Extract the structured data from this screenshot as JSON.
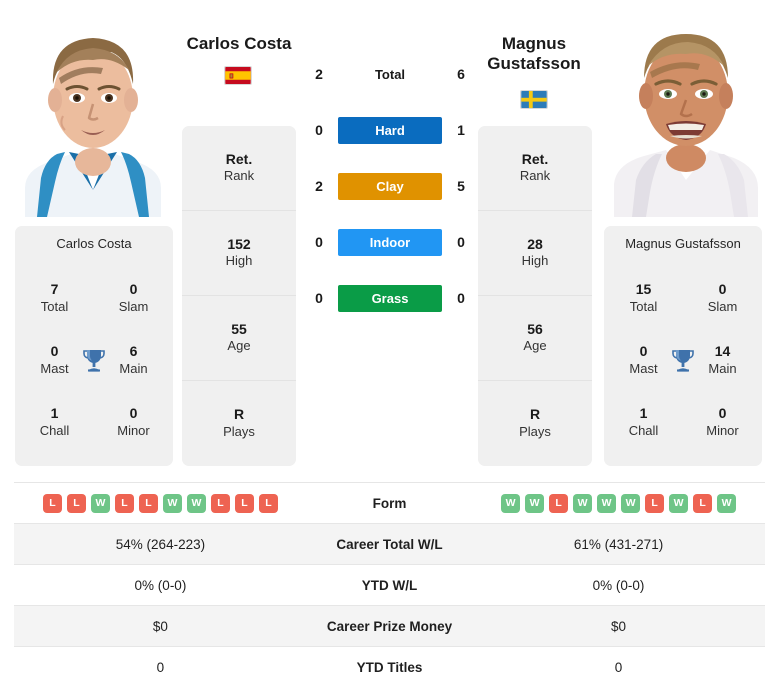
{
  "colors": {
    "hard": "#0a6cbf",
    "clay": "#e09200",
    "indoor": "#2196f3",
    "grass": "#0a9c47",
    "win": "#6ec587",
    "loss": "#ee6352",
    "trophy": "#3f72ab",
    "card_bg": "#f0f0f0"
  },
  "left_player": {
    "name": "Carlos Costa",
    "flag": "spain-flag",
    "photo": "carlos-costa-photo",
    "rank": [
      {
        "value": "Ret.",
        "label": "Rank"
      },
      {
        "value": "152",
        "label": "High"
      },
      {
        "value": "55",
        "label": "Age"
      },
      {
        "value": "R",
        "label": "Plays"
      }
    ],
    "titles_card_name": "Carlos Costa",
    "titles": [
      {
        "value": "7",
        "label": "Total"
      },
      {
        "value": "0",
        "label": "Slam"
      },
      {
        "value": "0",
        "label": "Mast"
      },
      {
        "value": "6",
        "label": "Main"
      },
      {
        "value": "1",
        "label": "Chall"
      },
      {
        "value": "0",
        "label": "Minor"
      }
    ],
    "form": [
      "L",
      "L",
      "W",
      "L",
      "L",
      "W",
      "W",
      "L",
      "L",
      "L"
    ]
  },
  "right_player": {
    "name": "Magnus Gustafsson",
    "flag": "sweden-flag",
    "photo": "magnus-gustafsson-photo",
    "rank": [
      {
        "value": "Ret.",
        "label": "Rank"
      },
      {
        "value": "28",
        "label": "High"
      },
      {
        "value": "56",
        "label": "Age"
      },
      {
        "value": "R",
        "label": "Plays"
      }
    ],
    "titles_card_name": "Magnus Gustafsson",
    "titles": [
      {
        "value": "15",
        "label": "Total"
      },
      {
        "value": "0",
        "label": "Slam"
      },
      {
        "value": "0",
        "label": "Mast"
      },
      {
        "value": "14",
        "label": "Main"
      },
      {
        "value": "1",
        "label": "Chall"
      },
      {
        "value": "0",
        "label": "Minor"
      }
    ],
    "form": [
      "W",
      "W",
      "L",
      "W",
      "W",
      "W",
      "L",
      "W",
      "L",
      "W"
    ]
  },
  "surfaces": [
    {
      "label": "Total",
      "left": "2",
      "right": "6",
      "style": "plain",
      "color": ""
    },
    {
      "label": "Hard",
      "left": "0",
      "right": "1",
      "style": "badge",
      "color": "#0a6cbf"
    },
    {
      "label": "Clay",
      "left": "2",
      "right": "5",
      "style": "badge",
      "color": "#e09200"
    },
    {
      "label": "Indoor",
      "left": "0",
      "right": "0",
      "style": "badge",
      "color": "#2196f3"
    },
    {
      "label": "Grass",
      "left": "0",
      "right": "0",
      "style": "badge",
      "color": "#0a9c47"
    }
  ],
  "table": {
    "rows": [
      {
        "label": "Form",
        "type": "form",
        "left": "",
        "right": "",
        "shaded": false
      },
      {
        "label": "Career Total W/L",
        "type": "text",
        "left": "54% (264-223)",
        "right": "61% (431-271)",
        "shaded": true
      },
      {
        "label": "YTD W/L",
        "type": "text",
        "left": "0% (0-0)",
        "right": "0% (0-0)",
        "shaded": false
      },
      {
        "label": "Career Prize Money",
        "type": "text",
        "left": "$0",
        "right": "$0",
        "shaded": true
      },
      {
        "label": "YTD Titles",
        "type": "text",
        "left": "0",
        "right": "0",
        "shaded": false
      }
    ]
  }
}
